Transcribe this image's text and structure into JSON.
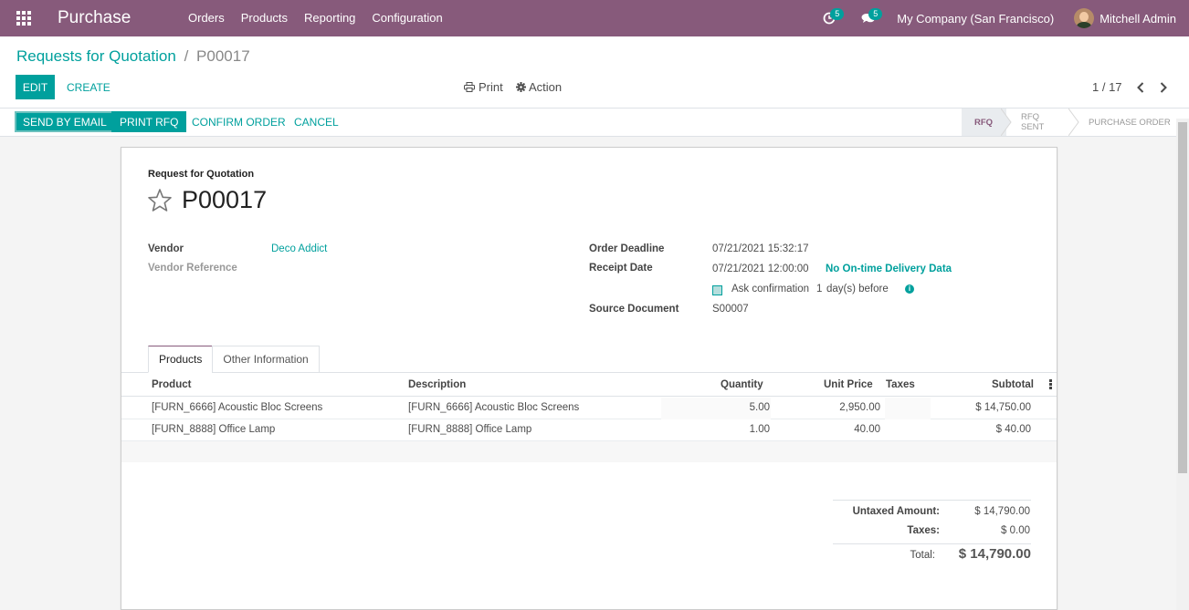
{
  "navbar": {
    "app_title": "Purchase",
    "menu": [
      "Orders",
      "Products",
      "Reporting",
      "Configuration"
    ],
    "activity_count": "5",
    "message_count": "5",
    "company": "My Company (San Francisco)",
    "user": "Mitchell Admin"
  },
  "breadcrumb": {
    "parent": "Requests for Quotation",
    "separator": "/",
    "current": "P00017"
  },
  "buttons": {
    "edit": "EDIT",
    "create": "CREATE",
    "print": "Print",
    "action": "Action"
  },
  "pager": {
    "value": "1 / 17"
  },
  "statusbar": {
    "send_email": "SEND BY EMAIL",
    "print_rfq": "PRINT RFQ",
    "confirm": "CONFIRM ORDER",
    "cancel": "CANCEL",
    "stages": [
      "RFQ",
      "RFQ SENT",
      "PURCHASE ORDER"
    ]
  },
  "form": {
    "doc_type": "Request for Quotation",
    "name": "P00017",
    "vendor_label": "Vendor",
    "vendor": "Deco Addict",
    "vendor_ref_label": "Vendor Reference",
    "order_deadline_label": "Order Deadline",
    "order_deadline": "07/21/2021 15:32:17",
    "receipt_date_label": "Receipt Date",
    "receipt_date": "07/21/2021 12:00:00",
    "delivery_data": "No On-time Delivery Data",
    "ask_confirmation": "Ask confirmation",
    "ask_days": "1",
    "days_before": "day(s) before",
    "source_doc_label": "Source Document",
    "source_doc": "S00007"
  },
  "tabs": [
    "Products",
    "Other Information"
  ],
  "lines": {
    "headers": {
      "product": "Product",
      "description": "Description",
      "quantity": "Quantity",
      "unit_price": "Unit Price",
      "taxes": "Taxes",
      "subtotal": "Subtotal"
    },
    "rows": [
      {
        "product": "[FURN_6666] Acoustic Bloc Screens",
        "description": "[FURN_6666] Acoustic Bloc Screens",
        "quantity": "5.00",
        "unit_price": "2,950.00",
        "taxes": "",
        "subtotal": "$ 14,750.00"
      },
      {
        "product": "[FURN_8888] Office Lamp",
        "description": "[FURN_8888] Office Lamp",
        "quantity": "1.00",
        "unit_price": "40.00",
        "taxes": "",
        "subtotal": "$ 40.00"
      }
    ]
  },
  "totals": {
    "untaxed_label": "Untaxed Amount:",
    "untaxed": "$ 14,790.00",
    "taxes_label": "Taxes:",
    "taxes": "$ 0.00",
    "total_label": "Total:",
    "total": "$ 14,790.00"
  },
  "colors": {
    "primary": "#00a09d",
    "brand": "#875a7b"
  }
}
